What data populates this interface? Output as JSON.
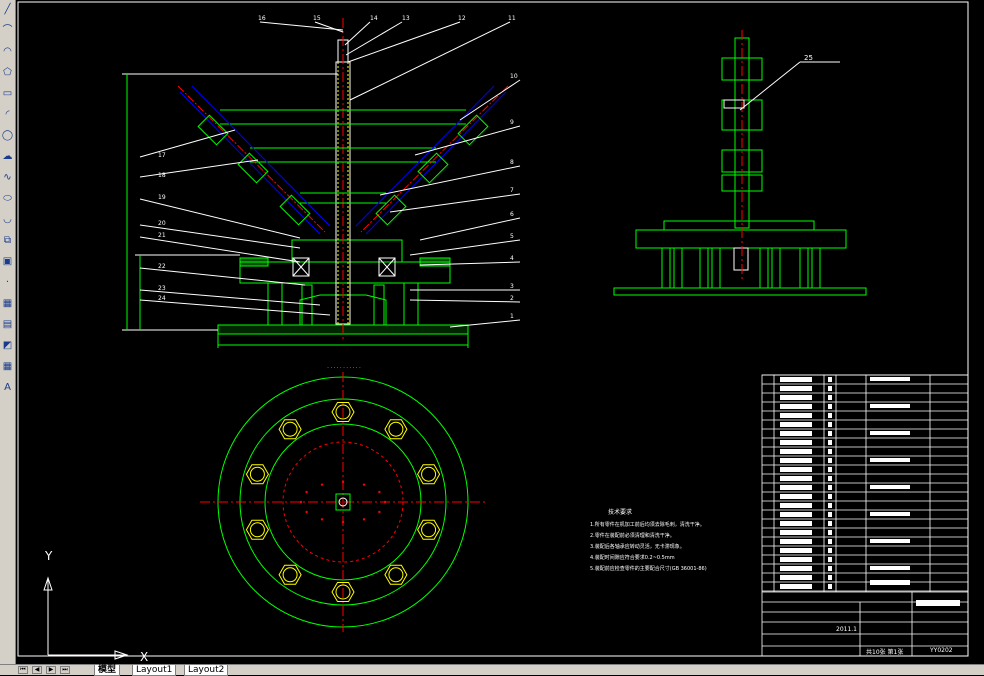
{
  "app": {
    "tool_icons": [
      "line-icon",
      "polyline-icon",
      "arc-icon",
      "polygon-icon",
      "rectangle-icon",
      "arc-tool-icon",
      "circle-icon",
      "revision-cloud-icon",
      "spline-icon",
      "ellipse-icon",
      "ellipse-arc-icon",
      "insert-block-icon",
      "make-block-icon",
      "point-icon",
      "hatch-icon",
      "gradient-icon",
      "region-icon",
      "table-icon",
      "multiline-text-icon"
    ],
    "text_tool_glyph": "A"
  },
  "tabs": {
    "model": "模型",
    "layout1": "Layout1",
    "layout2": "Layout2"
  },
  "ucs": {
    "y": "Y",
    "x": "X"
  },
  "colors": {
    "background": "#000000",
    "green": "#00ff00",
    "yellow": "#ffff00",
    "red": "#ff0000",
    "white": "#ffffff",
    "cyan": "#00ffff",
    "magenta": "#ff00ff"
  },
  "drawing": {
    "main_view_balloons_right": [
      "11",
      "12",
      "13",
      "14",
      "15",
      "16",
      "10",
      "9",
      "8",
      "7",
      "6",
      "5",
      "4",
      "3",
      "2",
      "1"
    ],
    "main_view_balloons_left": [
      "17",
      "18",
      "19",
      "20",
      "21",
      "22",
      "23",
      "24"
    ],
    "side_view_balloon": "25",
    "tech_title": "技术要求",
    "tech_notes": [
      "1.所有零件在机加工前后均须去除毛刺，清洗干净。",
      "2.零件在装配前必须清理和清洗干净。",
      "3.装配后各轴承应转动灵活，无卡滞现象。",
      "4.装配时间隙应符合要求0.2~0.5mm",
      "5.装配前应检查零件的主要配合尺寸(GB 36001-86)"
    ],
    "title_block": {
      "date": "2011.1",
      "drawing_no": "YY0202",
      "sheet": "共10张 第1张"
    }
  }
}
